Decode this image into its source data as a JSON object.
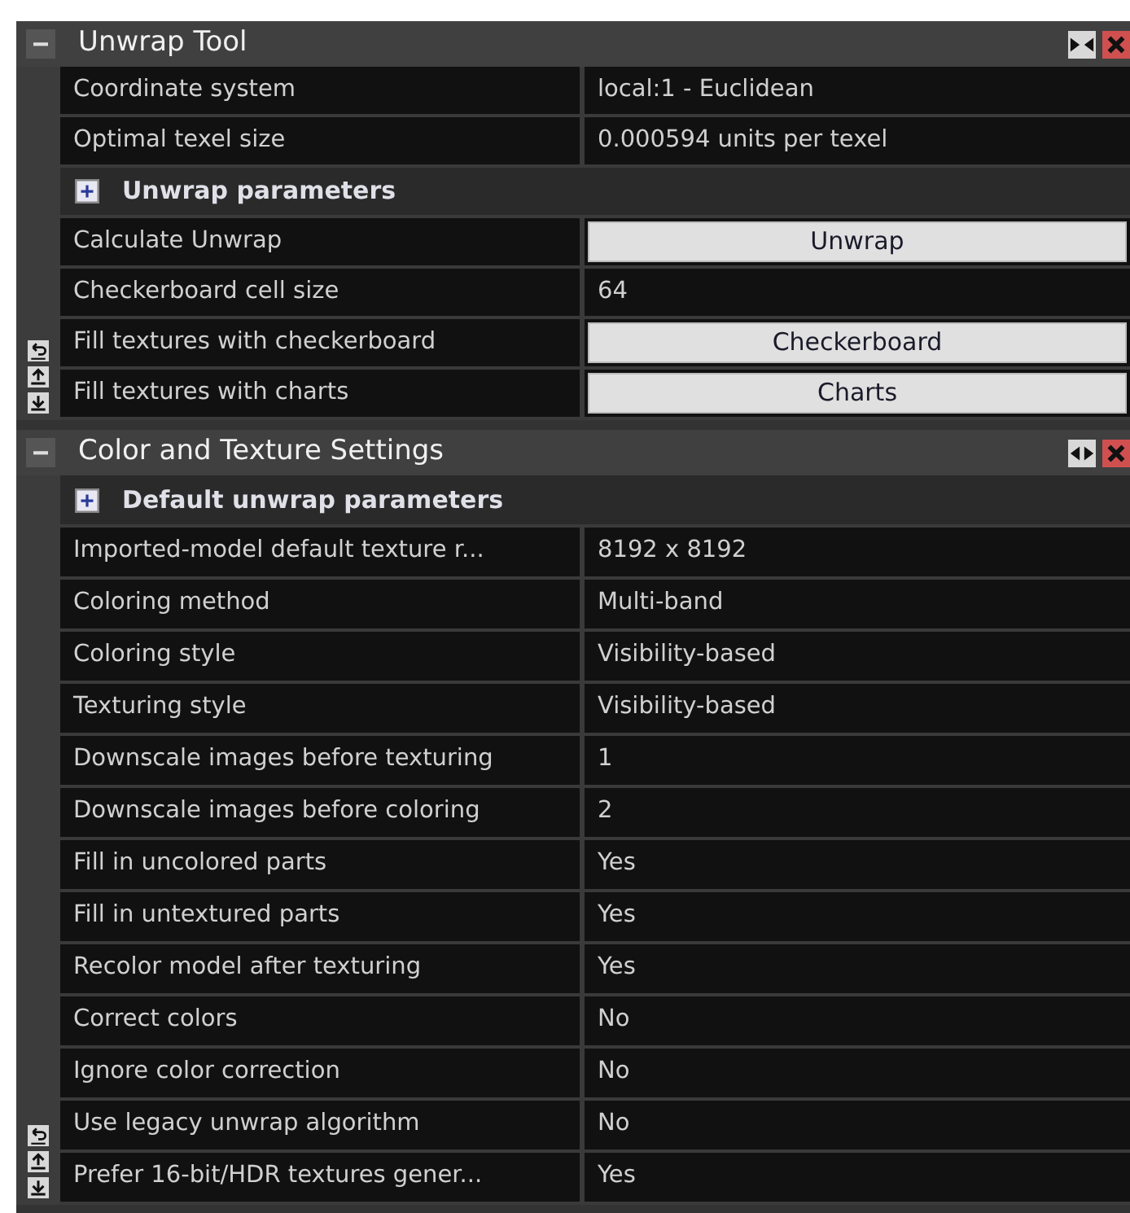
{
  "sections": [
    {
      "title": "Unwrap Tool",
      "expanded": true,
      "header_buttons": [
        {
          "kind": "collapse"
        },
        {
          "kind": "close"
        }
      ],
      "rows": [
        {
          "kind": "value",
          "label": "Coordinate system",
          "value": "local:1 - Euclidean"
        },
        {
          "kind": "value",
          "label": "Optimal texel size",
          "value": "0.000594 units per texel"
        },
        {
          "kind": "group",
          "label": "Unwrap parameters",
          "expanded": false
        },
        {
          "kind": "button",
          "label": "Calculate Unwrap",
          "value": "Unwrap"
        },
        {
          "kind": "value",
          "label": "Checkerboard cell size",
          "value": "64"
        },
        {
          "kind": "button",
          "label": "Fill textures with checkerboard",
          "value": "Checkerboard"
        },
        {
          "kind": "button",
          "label": "Fill textures with charts",
          "value": "Charts"
        }
      ]
    },
    {
      "title": "Color and Texture Settings",
      "expanded": true,
      "header_buttons": [
        {
          "kind": "expand"
        },
        {
          "kind": "close"
        }
      ],
      "rows": [
        {
          "kind": "group",
          "label": "Default unwrap parameters",
          "expanded": false
        },
        {
          "kind": "value",
          "label": "Imported-model default texture r...",
          "value": "8192 x 8192"
        },
        {
          "kind": "value",
          "label": "Coloring method",
          "value": "Multi-band"
        },
        {
          "kind": "value",
          "label": "Coloring style",
          "value": "Visibility-based"
        },
        {
          "kind": "value",
          "label": "Texturing style",
          "value": "Visibility-based"
        },
        {
          "kind": "value",
          "label": "Downscale images before texturing",
          "value": "1"
        },
        {
          "kind": "value",
          "label": "Downscale images before coloring",
          "value": "2"
        },
        {
          "kind": "value",
          "label": "Fill in uncolored parts",
          "value": "Yes"
        },
        {
          "kind": "value",
          "label": "Fill in untextured parts",
          "value": "Yes"
        },
        {
          "kind": "value",
          "label": "Recolor model after texturing",
          "value": "Yes"
        },
        {
          "kind": "value",
          "label": "Correct colors",
          "value": "No"
        },
        {
          "kind": "value",
          "label": "Ignore color correction",
          "value": "No"
        },
        {
          "kind": "value",
          "label": "Use legacy unwrap algorithm",
          "value": "No"
        },
        {
          "kind": "value",
          "label": "Prefer 16-bit/HDR textures gener...",
          "value": "Yes"
        }
      ]
    }
  ]
}
